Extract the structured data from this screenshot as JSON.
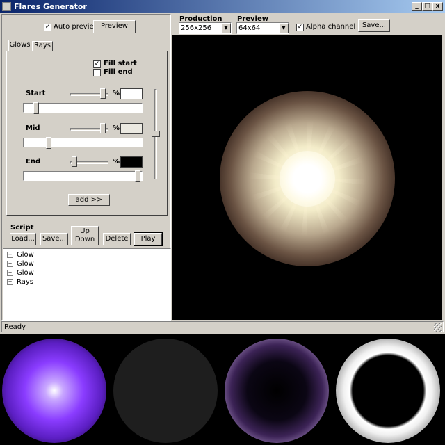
{
  "window": {
    "title": "Flares Generator",
    "status": "Ready"
  },
  "title_buttons": {
    "minimize": "_",
    "maximize": "□",
    "close": "x"
  },
  "left_panel": {
    "auto_preview": {
      "label": "Auto preview",
      "checked": true
    },
    "preview_button": "Preview",
    "tabs": [
      {
        "label": "Glows",
        "active": true
      },
      {
        "label": "Rays",
        "active": false
      }
    ],
    "fill_start": {
      "label": "Fill start",
      "checked": true
    },
    "fill_end": {
      "label": "Fill end",
      "checked": false
    },
    "rows": [
      {
        "label": "Start",
        "percent_symbol": "%",
        "color": "#ffffff",
        "top_slider_value": 0.95,
        "bottom_slider_value": 0.09
      },
      {
        "label": "Mid",
        "percent_symbol": "%",
        "color": "#ebe9e1",
        "top_slider_value": 0.95,
        "bottom_slider_value": 0.2
      },
      {
        "label": "End",
        "percent_symbol": "%",
        "color": "#000000",
        "top_slider_value": 0.05,
        "bottom_slider_value": 0.98
      }
    ],
    "vertical_slider_value": 0.5,
    "add_button": "add >>",
    "script": {
      "label": "Script",
      "load": "Load...",
      "save": "Save...",
      "up": "Up",
      "down": "Down",
      "delete": "Delete",
      "play": "Play"
    },
    "tree_items": [
      "Glow",
      "Glow",
      "Glow",
      "Rays"
    ]
  },
  "right_panel": {
    "production_label": "Production",
    "production_value": "256x256",
    "preview_label": "Preview",
    "preview_value": "64x64",
    "alpha_channel": {
      "label": "Alpha channel",
      "checked": true
    },
    "save_button": "Save..."
  },
  "colors": {
    "titlebar_start": "#0a246a",
    "titlebar_end": "#a6caf0",
    "face": "#d4d0c8",
    "flare_core": "#ffffff",
    "flare_glow": "#fdf2cf",
    "purple_glow": "#8a3cff"
  },
  "flares_icons": [
    "purple-glow-icon",
    "ring-icon",
    "purple-ring-icon",
    "white-ring-icon"
  ]
}
